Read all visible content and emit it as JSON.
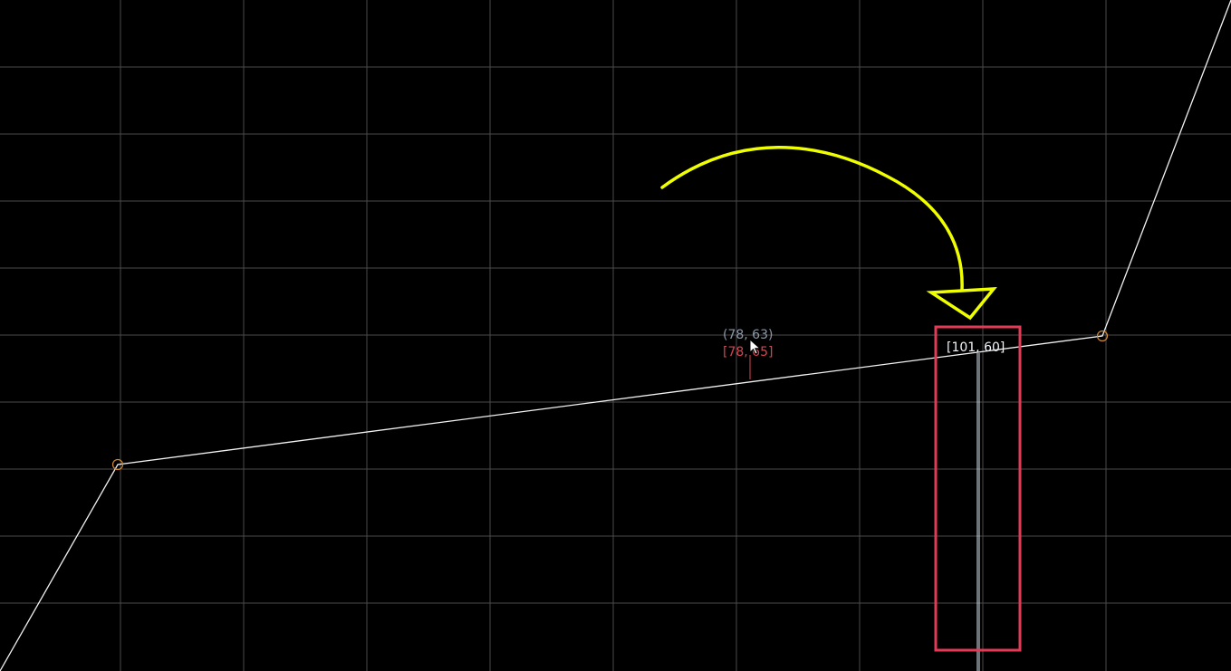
{
  "canvas": {
    "background_color": "#000000",
    "grid_color": "#4a4a4a",
    "curve_color": "#f2f2f2",
    "control_point_color": "#d08a32",
    "selected_line_color": "#dce6f5",
    "highlight_box_color": "#e23b57",
    "arrow_color": "#f0ff00"
  },
  "labels": {
    "cursor_position": "(78, 63)",
    "snapped_position": "[78, 65]",
    "selected_point": "[101, 60]"
  },
  "icons": {
    "cursor": "mouse-pointer-icon",
    "arrow": "annotation-arrow-icon"
  }
}
